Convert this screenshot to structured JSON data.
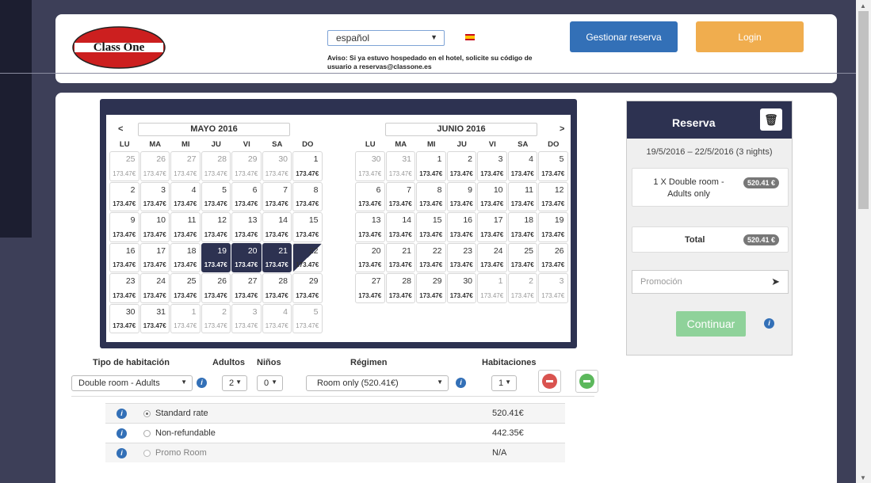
{
  "header": {
    "logo_text": "Class One",
    "language": "español",
    "notice": "Aviso: Si ya estuvo hospedado en el hotel, solicite su código de usuario a reservas@classone.es",
    "manage_label": "Gestionar reserva",
    "login_label": "Login"
  },
  "calendar": {
    "prev": "<",
    "next": ">",
    "weekdays": [
      "LU",
      "MA",
      "MI",
      "JU",
      "VI",
      "SA",
      "DO"
    ],
    "months": [
      {
        "title": "MAYO 2016",
        "days": [
          {
            "d": "25",
            "p": "173.47€",
            "off": true
          },
          {
            "d": "26",
            "p": "173.47€",
            "off": true
          },
          {
            "d": "27",
            "p": "173.47€",
            "off": true
          },
          {
            "d": "28",
            "p": "173.47€",
            "off": true
          },
          {
            "d": "29",
            "p": "173.47€",
            "off": true
          },
          {
            "d": "30",
            "p": "173.47€",
            "off": true
          },
          {
            "d": "1",
            "p": "173.47€"
          },
          {
            "d": "2",
            "p": "173.47€"
          },
          {
            "d": "3",
            "p": "173.47€"
          },
          {
            "d": "4",
            "p": "173.47€"
          },
          {
            "d": "5",
            "p": "173.47€"
          },
          {
            "d": "6",
            "p": "173.47€"
          },
          {
            "d": "7",
            "p": "173.47€"
          },
          {
            "d": "8",
            "p": "173.47€"
          },
          {
            "d": "9",
            "p": "173.47€"
          },
          {
            "d": "10",
            "p": "173.47€"
          },
          {
            "d": "11",
            "p": "173.47€"
          },
          {
            "d": "12",
            "p": "173.47€"
          },
          {
            "d": "13",
            "p": "173.47€"
          },
          {
            "d": "14",
            "p": "173.47€"
          },
          {
            "d": "15",
            "p": "173.47€"
          },
          {
            "d": "16",
            "p": "173.47€"
          },
          {
            "d": "17",
            "p": "173.47€"
          },
          {
            "d": "18",
            "p": "173.47€"
          },
          {
            "d": "19",
            "p": "173.47€",
            "sel": true
          },
          {
            "d": "20",
            "p": "173.47€",
            "sel": true
          },
          {
            "d": "21",
            "p": "173.47€",
            "sel": true
          },
          {
            "d": "22",
            "p": "173.47€",
            "half": true
          },
          {
            "d": "23",
            "p": "173.47€"
          },
          {
            "d": "24",
            "p": "173.47€"
          },
          {
            "d": "25",
            "p": "173.47€"
          },
          {
            "d": "26",
            "p": "173.47€"
          },
          {
            "d": "27",
            "p": "173.47€"
          },
          {
            "d": "28",
            "p": "173.47€"
          },
          {
            "d": "29",
            "p": "173.47€"
          },
          {
            "d": "30",
            "p": "173.47€"
          },
          {
            "d": "31",
            "p": "173.47€"
          },
          {
            "d": "1",
            "p": "173.47€",
            "off": true
          },
          {
            "d": "2",
            "p": "173.47€",
            "off": true
          },
          {
            "d": "3",
            "p": "173.47€",
            "off": true
          },
          {
            "d": "4",
            "p": "173.47€",
            "off": true
          },
          {
            "d": "5",
            "p": "173.47€",
            "off": true
          }
        ]
      },
      {
        "title": "JUNIO 2016",
        "days": [
          {
            "d": "30",
            "p": "173.47€",
            "off": true
          },
          {
            "d": "31",
            "p": "173.47€",
            "off": true
          },
          {
            "d": "1",
            "p": "173.47€"
          },
          {
            "d": "2",
            "p": "173.47€"
          },
          {
            "d": "3",
            "p": "173.47€"
          },
          {
            "d": "4",
            "p": "173.47€"
          },
          {
            "d": "5",
            "p": "173.47€"
          },
          {
            "d": "6",
            "p": "173.47€"
          },
          {
            "d": "7",
            "p": "173.47€"
          },
          {
            "d": "8",
            "p": "173.47€"
          },
          {
            "d": "9",
            "p": "173.47€"
          },
          {
            "d": "10",
            "p": "173.47€"
          },
          {
            "d": "11",
            "p": "173.47€"
          },
          {
            "d": "12",
            "p": "173.47€"
          },
          {
            "d": "13",
            "p": "173.47€"
          },
          {
            "d": "14",
            "p": "173.47€"
          },
          {
            "d": "15",
            "p": "173.47€"
          },
          {
            "d": "16",
            "p": "173.47€"
          },
          {
            "d": "17",
            "p": "173.47€"
          },
          {
            "d": "18",
            "p": "173.47€"
          },
          {
            "d": "19",
            "p": "173.47€"
          },
          {
            "d": "20",
            "p": "173.47€"
          },
          {
            "d": "21",
            "p": "173.47€"
          },
          {
            "d": "22",
            "p": "173.47€"
          },
          {
            "d": "23",
            "p": "173.47€"
          },
          {
            "d": "24",
            "p": "173.47€"
          },
          {
            "d": "25",
            "p": "173.47€"
          },
          {
            "d": "26",
            "p": "173.47€"
          },
          {
            "d": "27",
            "p": "173.47€"
          },
          {
            "d": "28",
            "p": "173.47€"
          },
          {
            "d": "29",
            "p": "173.47€"
          },
          {
            "d": "30",
            "p": "173.47€"
          },
          {
            "d": "1",
            "p": "173.47€",
            "off": true
          },
          {
            "d": "2",
            "p": "173.47€",
            "off": true
          },
          {
            "d": "3",
            "p": "173.47€",
            "off": true
          }
        ]
      }
    ]
  },
  "reservation": {
    "title": "Reserva",
    "dates": "19/5/2016 – 22/5/2016 (3 nights)",
    "item_label": "1 X Double room - Adults only",
    "item_price": "520.41 €",
    "total_label": "Total",
    "total_price": "520.41 €",
    "promo_placeholder": "Promoción",
    "continue_label": "Continuar"
  },
  "room_form": {
    "h_type": "Tipo de habitación",
    "h_adults": "Adultos",
    "h_children": "Niños",
    "h_board": "Régimen",
    "h_rooms": "Habitaciones",
    "room_type": "Double room - Adults",
    "adults": "2",
    "children": "0",
    "board": "Room only (520.41€)",
    "rooms": "1"
  },
  "rates": [
    {
      "name": "Standard rate",
      "price": "520.41€",
      "checked": true
    },
    {
      "name": "Non-refundable",
      "price": "442.35€",
      "checked": false
    },
    {
      "name": "Promo Room",
      "price": "N/A",
      "checked": false,
      "disabled": true
    }
  ]
}
